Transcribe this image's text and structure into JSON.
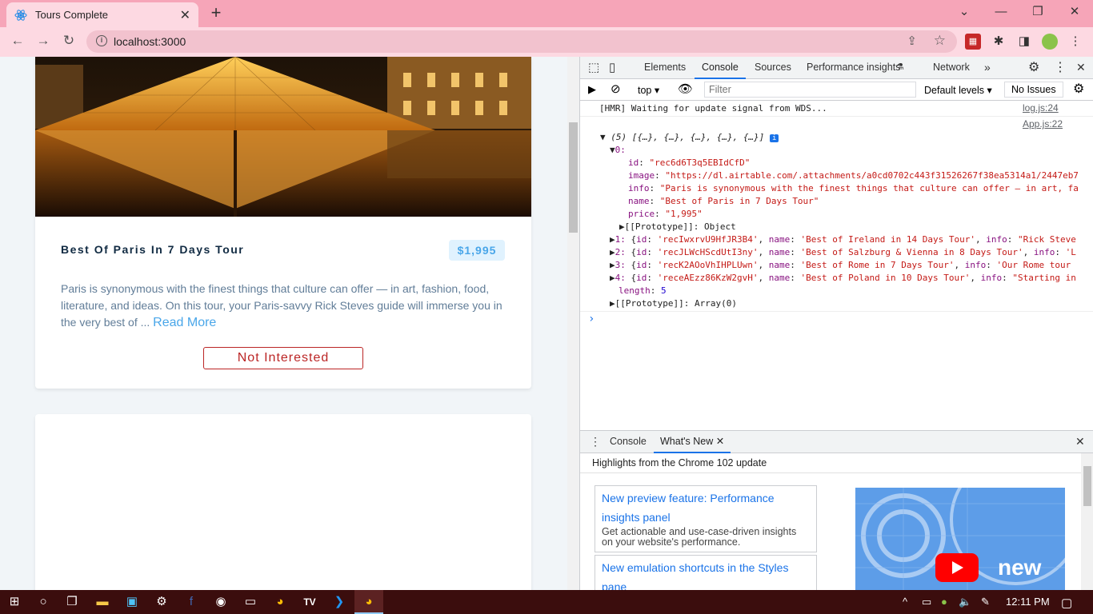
{
  "browser": {
    "tab_title": "Tours Complete",
    "url": "localhost:3000"
  },
  "tour": {
    "name": "Best Of Paris In 7 Days Tour",
    "price": "$1,995",
    "info": "Paris is synonymous with the finest things that culture can offer — in art, fashion, food, literature, and ideas. On this tour, your Paris-savvy Rick Steves guide will immerse you in the very best of ...",
    "read_more": "Read More",
    "not_interested": "Not Interested"
  },
  "devtools": {
    "tabs": [
      "Elements",
      "Console",
      "Sources",
      "Performance insights",
      "Network"
    ],
    "context": "top",
    "filter_placeholder": "Filter",
    "levels": "Default levels",
    "issues": "No Issues",
    "console": {
      "hmr_msg": "[HMR] Waiting for update signal from WDS...",
      "hmr_src": "log.js:24",
      "app_src": "App.js:22",
      "array_summary": "(5) [{…}, {…}, {…}, {…}, {…}]",
      "item0_label": "0:",
      "item0": [
        {
          "k": "id",
          "v": "\"rec6d6T3q5EBIdCfD\""
        },
        {
          "k": "image",
          "v": "\"https://dl.airtable.com/.attachments/a0cd0702c443f31526267f38ea5314a1/2447eb7"
        },
        {
          "k": "info",
          "v": "\"Paris is synonymous with the finest things that culture can offer — in art, fa"
        },
        {
          "k": "name",
          "v": "\"Best of Paris in 7 Days Tour\""
        },
        {
          "k": "price",
          "v": "\"1,995\""
        }
      ],
      "prototype_obj": "[[Prototype]]: Object",
      "items": [
        {
          "idx": "1:",
          "id": "'recIwxrvU9HfJR3B4'",
          "name": "'Best of Ireland in 14 Days Tour'",
          "info": "\"Rick Steve"
        },
        {
          "idx": "2:",
          "id": "'recJLWcHScdUtI3ny'",
          "name": "'Best of Salzburg & Vienna in 8 Days Tour'",
          "info": "'L"
        },
        {
          "idx": "3:",
          "id": "'recK2AOoVhIHPLUwn'",
          "name": "'Best of Rome in 7 Days Tour'",
          "info": "'Our Rome tour"
        },
        {
          "idx": "4:",
          "id": "'receAEzz86KzW2gvH'",
          "name": "'Best of Poland in 10 Days Tour'",
          "info": "\"Starting in"
        }
      ],
      "length_label": "length",
      "length_value": "5",
      "prototype_arr": "[[Prototype]]: Array(0)",
      "prompt": "›"
    },
    "drawer": {
      "tab_console": "Console",
      "tab_whatsnew": "What's New",
      "heading": "Highlights from the Chrome 102 update",
      "card1_title": "New preview feature: Performance insights panel",
      "card1_desc": "Get actionable and use-case-driven insights on your website's performance.",
      "card2_title": "New emulation shortcuts in the Styles pane",
      "video_text": "new"
    }
  },
  "taskbar": {
    "time": "12:11 PM"
  },
  "colors": {
    "chrome_tab_bg": "#f6a5b8",
    "price_text": "#49a6e9",
    "not_interested": "#bb2525",
    "taskbar": "#3b0d0d"
  }
}
